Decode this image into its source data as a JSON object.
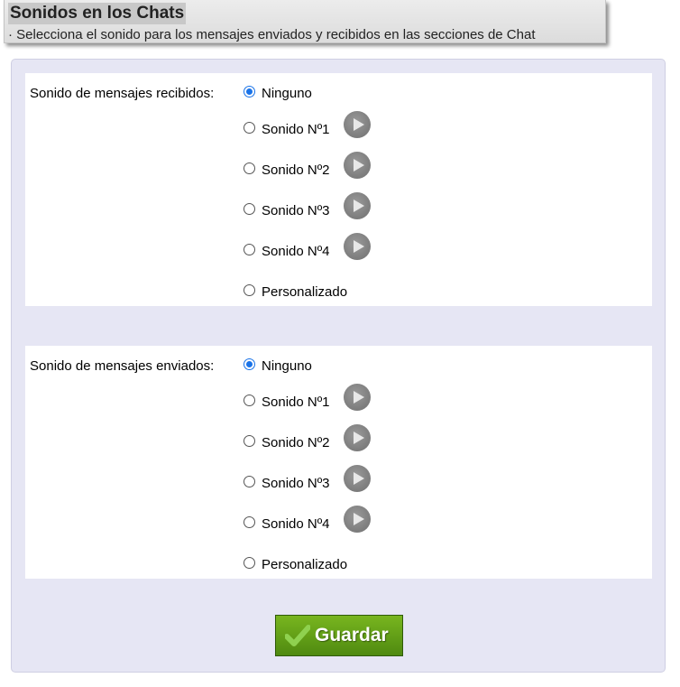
{
  "header": {
    "title": "Sonidos en los Chats",
    "subtitle": "· Selecciona el sonido para los mensajes enviados y recibidos en las secciones de Chat"
  },
  "sections": [
    {
      "label": "Sonido de mensajes recibidos:",
      "selected": "Ninguno",
      "options": [
        "Ninguno",
        "Sonido Nº1",
        "Sonido Nº2",
        "Sonido Nº3",
        "Sonido Nº4",
        "Personalizado"
      ]
    },
    {
      "label": "Sonido de mensajes enviados:",
      "selected": "Ninguno",
      "options": [
        "Ninguno",
        "Sonido Nº1",
        "Sonido Nº2",
        "Sonido Nº3",
        "Sonido Nº4",
        "Personalizado"
      ]
    }
  ],
  "save_button": {
    "label": "Guardar",
    "icon": "check-icon"
  },
  "colors": {
    "panel_bg": "#e6e6f4",
    "radio_accent": "#1a73e8",
    "play_icon": "#7a7a7a",
    "save_button": "#5f9e16"
  }
}
